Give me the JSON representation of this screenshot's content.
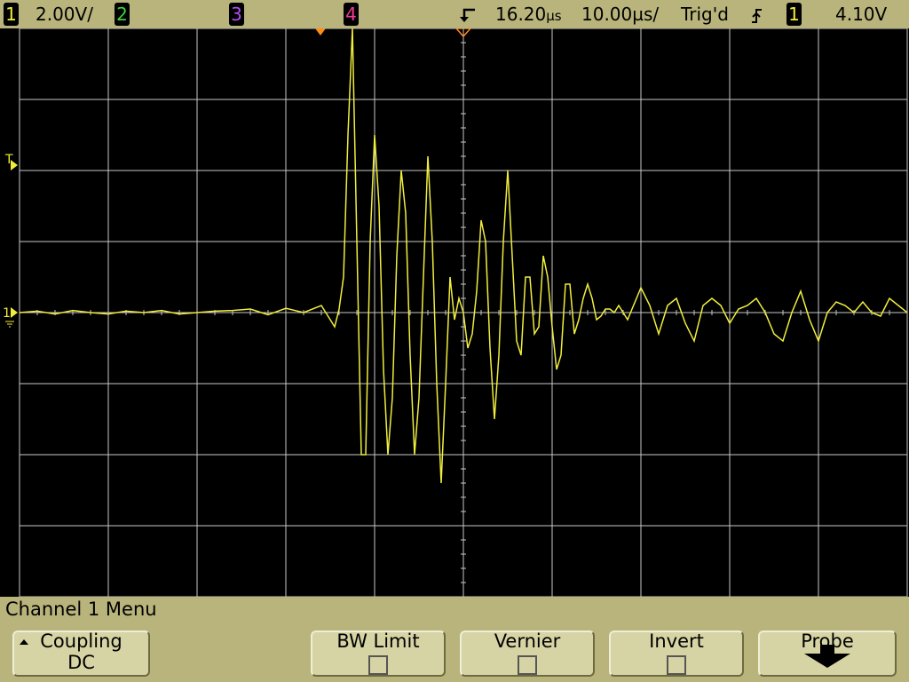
{
  "status": {
    "ch1_badge": "1",
    "ch1_scale": "2.00V/",
    "ch2_badge": "2",
    "ch3_badge": "3",
    "ch4_badge": "4",
    "delay": "16.20",
    "delay_unit": "µs",
    "timebase": "10.00",
    "timebase_unit": "µs/",
    "trigger_status": "Trig'd",
    "trigger_slope_icon": "rising-edge-icon",
    "trigger_source_badge": "1",
    "trigger_level": "4.10V"
  },
  "markers": {
    "trigger_level_label": "T",
    "ground_label": "1"
  },
  "colors": {
    "channel1": "#f0ee3c",
    "channel2": "#3cd23c",
    "channel3": "#b250f0",
    "channel4": "#f03c96",
    "grid": "#c8c8c8",
    "bezel": "#b8b47c",
    "trigger_marker": "#ff8c1a"
  },
  "waveform": {
    "units": "divisions",
    "t_div": [
      -5,
      -4.8,
      -4.6,
      -4.4,
      -4.2,
      -4,
      -3.8,
      -3.6,
      -3.4,
      -3.2,
      -3,
      -2.8,
      -2.6,
      -2.4,
      -2.2,
      -2,
      -1.8,
      -1.6,
      -1.5,
      -1.45,
      -1.4,
      -1.35,
      -1.3,
      -1.25,
      -1.2,
      -1.15,
      -1.1,
      -1.05,
      -1,
      -0.95,
      -0.9,
      -0.85,
      -0.8,
      -0.75,
      -0.7,
      -0.65,
      -0.6,
      -0.55,
      -0.5,
      -0.45,
      -0.4,
      -0.35,
      -0.3,
      -0.25,
      -0.2,
      -0.15,
      -0.1,
      -0.05,
      0,
      0.05,
      0.1,
      0.15,
      0.2,
      0.25,
      0.3,
      0.35,
      0.4,
      0.45,
      0.5,
      0.55,
      0.6,
      0.65,
      0.7,
      0.75,
      0.8,
      0.85,
      0.9,
      0.95,
      1,
      1.05,
      1.1,
      1.15,
      1.2,
      1.25,
      1.3,
      1.35,
      1.4,
      1.45,
      1.5,
      1.55,
      1.6,
      1.65,
      1.7,
      1.75,
      1.8,
      1.85,
      1.9,
      2,
      2.1,
      2.2,
      2.3,
      2.4,
      2.5,
      2.6,
      2.7,
      2.8,
      2.9,
      3,
      3.1,
      3.2,
      3.3,
      3.4,
      3.5,
      3.6,
      3.7,
      3.8,
      3.9,
      4,
      4.1,
      4.2,
      4.3,
      4.4,
      4.5,
      4.6,
      4.7,
      4.8,
      4.9,
      5
    ],
    "v_div": [
      0,
      0.02,
      -0.02,
      0.03,
      0,
      -0.02,
      0.02,
      0,
      0.03,
      -0.02,
      0,
      0.02,
      0.03,
      0.05,
      -0.03,
      0.06,
      0.0,
      0.1,
      -0.1,
      -0.2,
      0.05,
      0.5,
      2.5,
      4.0,
      1.0,
      -2.0,
      -2.0,
      1.0,
      2.5,
      1.5,
      -0.8,
      -2.0,
      -1.2,
      0.8,
      2.0,
      1.4,
      -0.6,
      -2.0,
      -1.2,
      0.5,
      2.2,
      1.0,
      -1.0,
      -2.4,
      -1.0,
      0.5,
      -0.1,
      0.2,
      0,
      -0.5,
      -0.3,
      0.3,
      1.3,
      1.0,
      -0.5,
      -1.5,
      -0.6,
      1.0,
      2.0,
      0.8,
      -0.4,
      -0.6,
      0.5,
      0.5,
      -0.3,
      -0.2,
      0.8,
      0.5,
      -0.2,
      -0.8,
      -0.6,
      0.4,
      0.4,
      -0.3,
      -0.1,
      0.2,
      0.4,
      0.2,
      -0.1,
      -0.05,
      0.05,
      0.05,
      0.0,
      0.1,
      0.0,
      -0.1,
      0.05,
      0.35,
      0.1,
      -0.3,
      0.1,
      0.2,
      -0.15,
      -0.4,
      0.1,
      0.2,
      0.1,
      -0.15,
      0.05,
      0.1,
      0.2,
      0.0,
      -0.3,
      -0.4,
      0.0,
      0.3,
      -0.1,
      -0.4,
      0.0,
      0.15,
      0.1,
      0.0,
      0.15,
      0.0,
      -0.05,
      0.2,
      0.1,
      0.0,
      0.05
    ]
  },
  "menu": {
    "title": "Channel 1  Menu",
    "coupling_label": "Coupling",
    "coupling_value": "DC",
    "bw_limit_label": "BW Limit",
    "vernier_label": "Vernier",
    "invert_label": "Invert",
    "probe_label": "Probe"
  }
}
